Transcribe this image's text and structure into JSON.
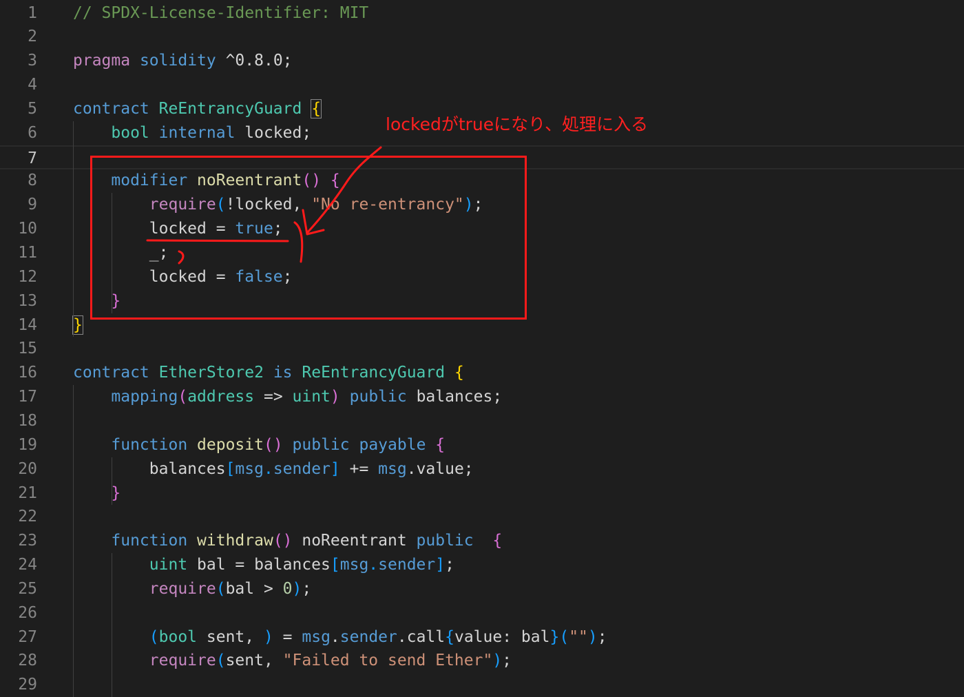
{
  "editor": {
    "lines": [
      {
        "n": "1",
        "tokens": [
          {
            "t": "// SPDX-License-Identifier: MIT",
            "c": "cmt"
          }
        ]
      },
      {
        "n": "2",
        "tokens": []
      },
      {
        "n": "3",
        "tokens": [
          {
            "t": "pragma",
            "c": "ctl"
          },
          {
            "t": " "
          },
          {
            "t": "solidity",
            "c": "kw"
          },
          {
            "t": " ^0.8.0;"
          }
        ]
      },
      {
        "n": "4",
        "tokens": []
      },
      {
        "n": "5",
        "tokens": [
          {
            "t": "contract",
            "c": "kw"
          },
          {
            "t": " "
          },
          {
            "t": "ReEntrancyGuard",
            "c": "typ"
          },
          {
            "t": " "
          },
          {
            "t": "{",
            "c": "b1 bracket-match"
          }
        ]
      },
      {
        "n": "6",
        "tokens": [
          {
            "t": "    "
          },
          {
            "t": "bool",
            "c": "typ"
          },
          {
            "t": " "
          },
          {
            "t": "internal",
            "c": "kw"
          },
          {
            "t": " locked;"
          }
        ]
      },
      {
        "n": "7",
        "tokens": [],
        "active": true
      },
      {
        "n": "8",
        "tokens": [
          {
            "t": "    "
          },
          {
            "t": "modifier",
            "c": "kw"
          },
          {
            "t": " "
          },
          {
            "t": "noReentrant",
            "c": "fn"
          },
          {
            "t": "()",
            "c": "b2"
          },
          {
            "t": " "
          },
          {
            "t": "{",
            "c": "b2"
          }
        ]
      },
      {
        "n": "9",
        "tokens": [
          {
            "t": "        "
          },
          {
            "t": "require",
            "c": "ctl"
          },
          {
            "t": "(",
            "c": "b3"
          },
          {
            "t": "!locked, "
          },
          {
            "t": "\"No re-entrancy\"",
            "c": "str"
          },
          {
            "t": ")",
            "c": "b3"
          },
          {
            "t": ";"
          }
        ]
      },
      {
        "n": "10",
        "tokens": [
          {
            "t": "        locked = "
          },
          {
            "t": "true",
            "c": "kw"
          },
          {
            "t": ";"
          }
        ]
      },
      {
        "n": "11",
        "tokens": [
          {
            "t": "        _;"
          }
        ]
      },
      {
        "n": "12",
        "tokens": [
          {
            "t": "        locked = "
          },
          {
            "t": "false",
            "c": "kw"
          },
          {
            "t": ";"
          }
        ]
      },
      {
        "n": "13",
        "tokens": [
          {
            "t": "    "
          },
          {
            "t": "}",
            "c": "b2"
          }
        ]
      },
      {
        "n": "14",
        "tokens": [
          {
            "t": "}",
            "c": "b1 bracket-match"
          }
        ]
      },
      {
        "n": "15",
        "tokens": []
      },
      {
        "n": "16",
        "tokens": [
          {
            "t": "contract",
            "c": "kw"
          },
          {
            "t": " "
          },
          {
            "t": "EtherStore2",
            "c": "typ"
          },
          {
            "t": " "
          },
          {
            "t": "is",
            "c": "kw"
          },
          {
            "t": " "
          },
          {
            "t": "ReEntrancyGuard",
            "c": "typ"
          },
          {
            "t": " "
          },
          {
            "t": "{",
            "c": "b1"
          }
        ]
      },
      {
        "n": "17",
        "tokens": [
          {
            "t": "    "
          },
          {
            "t": "mapping",
            "c": "kw"
          },
          {
            "t": "(",
            "c": "b2"
          },
          {
            "t": "address",
            "c": "typ"
          },
          {
            "t": " => "
          },
          {
            "t": "uint",
            "c": "typ"
          },
          {
            "t": ")",
            "c": "b2"
          },
          {
            "t": " "
          },
          {
            "t": "public",
            "c": "kw"
          },
          {
            "t": " balances;"
          }
        ]
      },
      {
        "n": "18",
        "tokens": []
      },
      {
        "n": "19",
        "tokens": [
          {
            "t": "    "
          },
          {
            "t": "function",
            "c": "kw"
          },
          {
            "t": " "
          },
          {
            "t": "deposit",
            "c": "fn"
          },
          {
            "t": "()",
            "c": "b2"
          },
          {
            "t": " "
          },
          {
            "t": "public",
            "c": "kw"
          },
          {
            "t": " "
          },
          {
            "t": "payable",
            "c": "kw"
          },
          {
            "t": " "
          },
          {
            "t": "{",
            "c": "b2"
          }
        ]
      },
      {
        "n": "20",
        "tokens": [
          {
            "t": "        balances"
          },
          {
            "t": "[",
            "c": "b3"
          },
          {
            "t": "msg",
            "c": "kw"
          },
          {
            "t": ".",
            "c": "b3"
          },
          {
            "t": "sender",
            "c": "kw"
          },
          {
            "t": "]",
            "c": "b3"
          },
          {
            "t": " += "
          },
          {
            "t": "msg",
            "c": "kw"
          },
          {
            "t": ".value;"
          }
        ]
      },
      {
        "n": "21",
        "tokens": [
          {
            "t": "    "
          },
          {
            "t": "}",
            "c": "b2"
          }
        ]
      },
      {
        "n": "22",
        "tokens": []
      },
      {
        "n": "23",
        "tokens": [
          {
            "t": "    "
          },
          {
            "t": "function",
            "c": "kw"
          },
          {
            "t": " "
          },
          {
            "t": "withdraw",
            "c": "fn"
          },
          {
            "t": "()",
            "c": "b2"
          },
          {
            "t": " noReentrant "
          },
          {
            "t": "public",
            "c": "kw"
          },
          {
            "t": "  "
          },
          {
            "t": "{",
            "c": "b2"
          }
        ]
      },
      {
        "n": "24",
        "tokens": [
          {
            "t": "        "
          },
          {
            "t": "uint",
            "c": "typ"
          },
          {
            "t": " bal = balances"
          },
          {
            "t": "[",
            "c": "b3"
          },
          {
            "t": "msg",
            "c": "kw"
          },
          {
            "t": ".",
            "c": "b3"
          },
          {
            "t": "sender",
            "c": "kw"
          },
          {
            "t": "]",
            "c": "b3"
          },
          {
            "t": ";"
          }
        ]
      },
      {
        "n": "25",
        "tokens": [
          {
            "t": "        "
          },
          {
            "t": "require",
            "c": "ctl"
          },
          {
            "t": "(",
            "c": "b3"
          },
          {
            "t": "bal > "
          },
          {
            "t": "0",
            "c": "num"
          },
          {
            "t": ")",
            "c": "b3"
          },
          {
            "t": ";"
          }
        ]
      },
      {
        "n": "26",
        "tokens": []
      },
      {
        "n": "27",
        "tokens": [
          {
            "t": "        "
          },
          {
            "t": "(",
            "c": "b3"
          },
          {
            "t": "bool",
            "c": "typ"
          },
          {
            "t": " sent, "
          },
          {
            "t": ")",
            "c": "b3"
          },
          {
            "t": " = "
          },
          {
            "t": "msg",
            "c": "kw"
          },
          {
            "t": "."
          },
          {
            "t": "sender",
            "c": "kw"
          },
          {
            "t": ".call"
          },
          {
            "t": "{",
            "c": "b3"
          },
          {
            "t": "value: bal"
          },
          {
            "t": "}",
            "c": "b3"
          },
          {
            "t": "(",
            "c": "b3"
          },
          {
            "t": "\"\"",
            "c": "str"
          },
          {
            "t": ")",
            "c": "b3"
          },
          {
            "t": ";"
          }
        ]
      },
      {
        "n": "28",
        "tokens": [
          {
            "t": "        "
          },
          {
            "t": "require",
            "c": "ctl"
          },
          {
            "t": "(",
            "c": "b3"
          },
          {
            "t": "sent, "
          },
          {
            "t": "\"Failed to send Ether\"",
            "c": "str"
          },
          {
            "t": ")",
            "c": "b3"
          },
          {
            "t": ";"
          }
        ]
      },
      {
        "n": "29",
        "tokens": []
      }
    ]
  },
  "annotation": {
    "label": "lockedがtrueになり、処理に入る",
    "color": "#ff1a1a"
  }
}
